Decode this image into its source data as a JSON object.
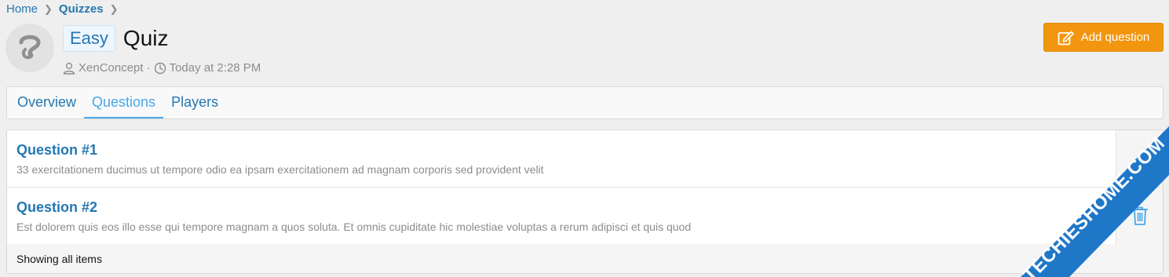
{
  "breadcrumb": {
    "items": [
      {
        "label": "Home"
      },
      {
        "label": "Quizzes"
      }
    ]
  },
  "quiz": {
    "badge": "Easy",
    "title": "Quiz",
    "author": "XenConcept",
    "separator": "·",
    "date": "Today at 2:28 PM"
  },
  "actions": {
    "add_question_label": "Add question"
  },
  "tabs": [
    {
      "label": "Overview",
      "active": false
    },
    {
      "label": "Questions",
      "active": true
    },
    {
      "label": "Players",
      "active": false
    }
  ],
  "questions": [
    {
      "title": "Question #1",
      "description": "33 exercitationem ducimus ut tempore odio ea ipsam exercitationem ad magnam corporis sed provident velit",
      "action_icon": "edit-icon"
    },
    {
      "title": "Question #2",
      "description": "Est dolorem quis eos illo esse qui tempore magnam a quos soluta. Et omnis cupiditate hic molestiae voluptas a rerum adipisci et quis quod",
      "action_icon": "trash-icon"
    }
  ],
  "footer": {
    "status": "Showing all items"
  },
  "watermark": {
    "text": "TECHIESHOME.COM"
  },
  "colors": {
    "link": "#2577b1",
    "accent": "#f3960f",
    "active_tab": "#47a7eb",
    "watermark": "#1f77c8"
  }
}
